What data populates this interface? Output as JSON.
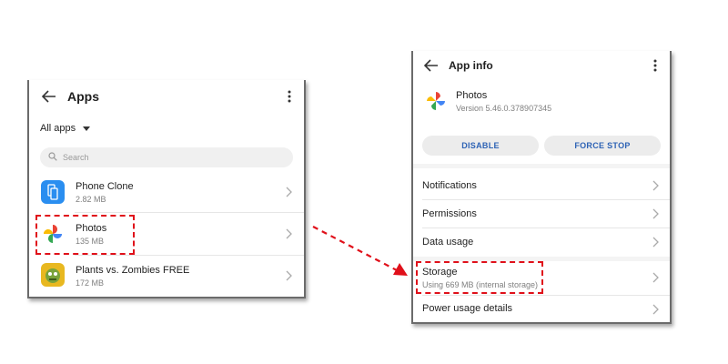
{
  "left": {
    "header": {
      "title": "Apps"
    },
    "filter": {
      "label": "All apps"
    },
    "search": {
      "placeholder": "Search"
    },
    "apps": [
      {
        "name": "Phone Clone",
        "size": "2.82 MB",
        "icon": "phone-clone-icon"
      },
      {
        "name": "Photos",
        "size": "135 MB",
        "icon": "photos-icon"
      },
      {
        "name": "Plants vs. Zombies FREE",
        "size": "172 MB",
        "icon": "plants-vs-zombies-icon"
      }
    ]
  },
  "right": {
    "header": {
      "title": "App info"
    },
    "app": {
      "name": "Photos",
      "version": "Version 5.46.0.378907345"
    },
    "buttons": {
      "disable": "DISABLE",
      "force_stop": "FORCE STOP"
    },
    "rows": [
      {
        "label": "Notifications"
      },
      {
        "label": "Permissions"
      },
      {
        "label": "Data usage"
      },
      {
        "label": "Storage",
        "sub": "Using 669 MB (internal storage)"
      },
      {
        "label": "Power usage details"
      }
    ]
  },
  "colors": {
    "accent_button_text": "#2e63b5",
    "highlight": "#e0101a",
    "arrow": "#e0101a"
  }
}
